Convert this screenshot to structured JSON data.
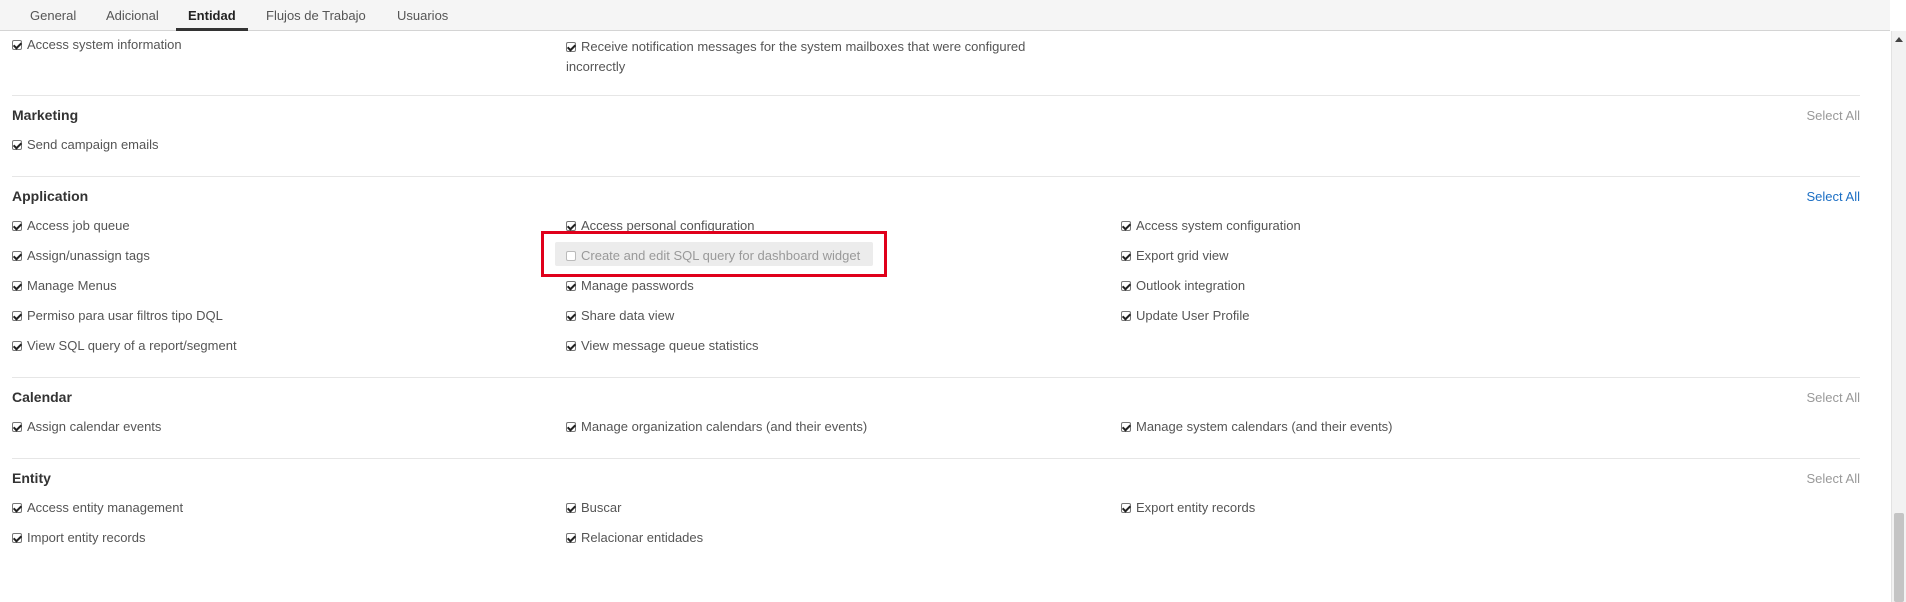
{
  "tabs": [
    {
      "label": "General"
    },
    {
      "label": "Adicional"
    },
    {
      "label": "Entidad"
    },
    {
      "label": "Flujos de Trabajo"
    },
    {
      "label": "Usuarios"
    }
  ],
  "active_tab": "Entidad",
  "top_items": [
    {
      "label": "Access system information",
      "checked": true
    },
    {
      "label": "Receive notification messages for the system mailboxes that were configured incorrectly",
      "checked": true
    }
  ],
  "sections": {
    "marketing": {
      "title": "Marketing",
      "select_all": "Select All",
      "items": [
        {
          "label": "Send campaign emails",
          "checked": true
        }
      ]
    },
    "application": {
      "title": "Application",
      "select_all": "Select All",
      "items": [
        {
          "label": "Access job queue",
          "checked": true
        },
        {
          "label": "Access personal configuration",
          "checked": true
        },
        {
          "label": "Access system configuration",
          "checked": true
        },
        {
          "label": "Assign/unassign tags",
          "checked": true
        },
        {
          "label": "Create and edit SQL query for dashboard widget",
          "checked": false
        },
        {
          "label": "Export grid view",
          "checked": true
        },
        {
          "label": "Manage Menus",
          "checked": true
        },
        {
          "label": "Manage passwords",
          "checked": true
        },
        {
          "label": "Outlook integration",
          "checked": true
        },
        {
          "label": "Permiso para usar filtros tipo DQL",
          "checked": true
        },
        {
          "label": "Share data view",
          "checked": true
        },
        {
          "label": "Update User Profile",
          "checked": true
        },
        {
          "label": "View SQL query of a report/segment",
          "checked": true
        },
        {
          "label": "View message queue statistics",
          "checked": true
        }
      ]
    },
    "calendar": {
      "title": "Calendar",
      "select_all": "Select All",
      "items": [
        {
          "label": "Assign calendar events",
          "checked": true
        },
        {
          "label": "Manage organization calendars (and their events)",
          "checked": true
        },
        {
          "label": "Manage system calendars (and their events)",
          "checked": true
        }
      ]
    },
    "entity": {
      "title": "Entity",
      "select_all": "Select All",
      "items": [
        {
          "label": "Access entity management",
          "checked": true
        },
        {
          "label": "Buscar",
          "checked": true
        },
        {
          "label": "Export entity records",
          "checked": true
        },
        {
          "label": "Import entity records",
          "checked": true
        },
        {
          "label": "Relacionar entidades",
          "checked": true
        }
      ]
    }
  },
  "colors": {
    "highlight": "#e0001b",
    "link": "#1c6fc4",
    "muted_link": "#999999"
  }
}
